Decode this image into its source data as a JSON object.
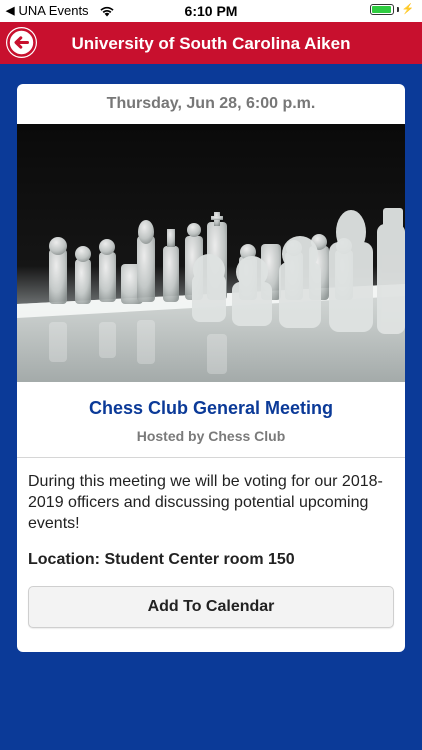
{
  "status_bar": {
    "back_chip": "◀",
    "carrier_label": "UNA Events",
    "time": "6:10 PM",
    "battery_level": 0.95,
    "battery_color": "#2ecc40",
    "icons": [
      "wifi-icon",
      "battery-icon",
      "charging-bolt-icon"
    ]
  },
  "nav": {
    "title": "University of South Carolina Aiken",
    "back_icon": "back-arrow-circle-icon",
    "bar_color": "#c8102e"
  },
  "event": {
    "date_time": "Thursday, Jun 28, 6:00 p.m.",
    "image_subject": "chess-pieces-photo",
    "title": "Chess Club General Meeting",
    "host": "Hosted by Chess Club",
    "description": "During this meeting we will be voting for our 2018-2019 officers and discussing potential upcoming events!",
    "location": "Location: Student Center room 150",
    "calendar_button_label": "Add To Calendar"
  },
  "colors": {
    "background": "#0b3a98",
    "title_blue": "#0b3a98",
    "accent_red": "#c8102e"
  }
}
